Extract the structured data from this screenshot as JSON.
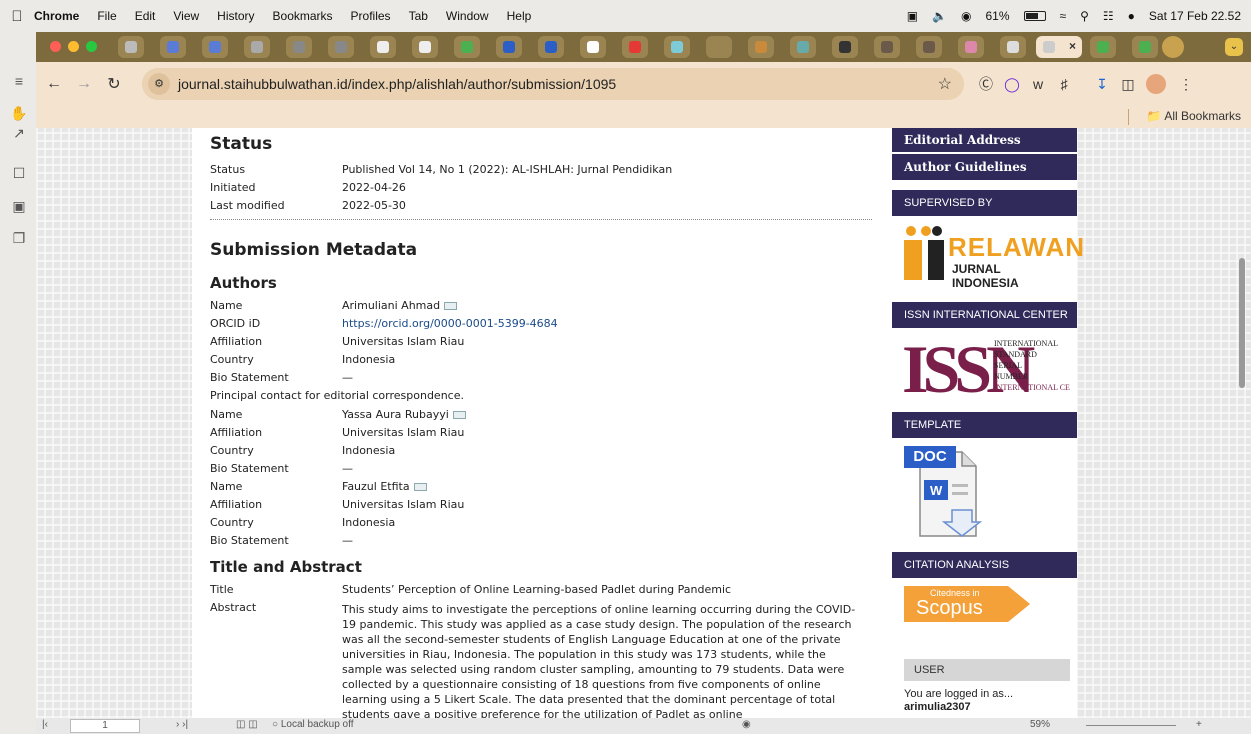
{
  "menubar": {
    "app": "Chrome",
    "items": [
      "File",
      "Edit",
      "View",
      "History",
      "Bookmarks",
      "Profiles",
      "Tab",
      "Window",
      "Help"
    ],
    "battery": "61%",
    "clock": "Sat 17 Feb 22.52"
  },
  "browser": {
    "url": "journal.staihubbulwathan.id/index.php/alishlah/author/submission/1095",
    "all_bookmarks": "All Bookmarks"
  },
  "status": {
    "heading": "Status",
    "rows": [
      {
        "label": "Status",
        "value": "Published   Vol 14, No 1 (2022): AL-ISHLAH: Jurnal Pendidikan"
      },
      {
        "label": "Initiated",
        "value": "2022-04-26"
      },
      {
        "label": "Last modified",
        "value": "2022-05-30"
      }
    ]
  },
  "metadata": {
    "heading": "Submission Metadata",
    "authors_heading": "Authors",
    "principal_note": "Principal contact for editorial correspondence.",
    "labels": {
      "name": "Name",
      "orcid": "ORCID iD",
      "affiliation": "Affiliation",
      "country": "Country",
      "bio": "Bio Statement"
    },
    "authors": [
      {
        "name": "Arimuliani Ahmad",
        "orcid": "https://orcid.org/0000-0001-5399-4684",
        "affiliation": "Universitas Islam Riau",
        "country": "Indonesia",
        "bio": "—"
      },
      {
        "name": "Yassa Aura Rubayyi",
        "affiliation": "Universitas Islam Riau",
        "country": "Indonesia",
        "bio": "—"
      },
      {
        "name": "Fauzul Etfita",
        "affiliation": "Universitas Islam Riau",
        "country": "Indonesia",
        "bio": "—"
      }
    ],
    "title_abstract_heading": "Title and Abstract",
    "title_label": "Title",
    "title": "Students’ Perception of Online Learning-based Padlet during Pandemic",
    "abstract_label": "Abstract",
    "abstract": "This study aims to investigate the perceptions of online learning occurring during the COVID-19 pandemic. This study was applied as a case study design. The population of the research was all the second-semester students of English Language Education at one of the private universities in Riau, Indonesia. The population in this study was 173 students, while the sample was selected using random cluster sampling, amounting to 79 students. Data were collected by a questionnaire consisting of 18 questions from five components of online learning using a 5 Likert Scale. The data presented that the dominant percentage of total students gave a positive preference for the utilization of Padlet as online"
  },
  "sidebar": {
    "nav": [
      "Editorial Address",
      "Author Guidelines"
    ],
    "supervised_by": "SUPERVISED BY",
    "relawan": {
      "line1": "RELAWAN",
      "line2": "JURNAL INDONESIA"
    },
    "issn_header": "ISSN INTERNATIONAL CENTER",
    "issn": {
      "logo": "ISSN",
      "lines": [
        "INTERNATIONAL",
        "STANDARD",
        "SERIAL",
        "NUMBER",
        "INTERNATIONAL CE"
      ]
    },
    "template_header": "TEMPLATE",
    "doc_label": "DOC",
    "citation_header": "CITATION ANALYSIS",
    "scopus": {
      "small": "Citedness in",
      "big": "Scopus"
    },
    "user_header": "USER",
    "logged_in": "You are logged in as...",
    "username": "arimulia2307"
  },
  "bottombar": {
    "backup": "Local backup off",
    "page": "1",
    "zoom": "59%"
  }
}
